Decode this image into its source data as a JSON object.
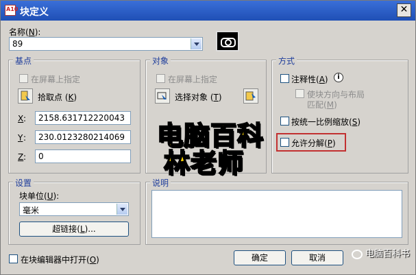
{
  "window": {
    "title": "块定义",
    "app_icon_text": "A10"
  },
  "name_field": {
    "label": "名称",
    "hotkey": "N",
    "value": "89"
  },
  "base_point": {
    "group_title": "基点",
    "specify_on_screen": "在屏幕上指定",
    "pick_point": "拾取点",
    "pick_point_hotkey": "K",
    "x_label": "X",
    "x_value": "2158.631712220043",
    "y_label": "Y",
    "y_value": "230.0123280214069",
    "z_label": "Z",
    "z_value": "0"
  },
  "objects": {
    "group_title": "对象",
    "specify_on_screen": "在屏幕上指定",
    "select_objects": "选择对象",
    "select_objects_hotkey": "T"
  },
  "behavior": {
    "group_title": "方式",
    "annotative": "注释性",
    "annotative_hotkey": "A",
    "match_orientation": "使块方向与布局",
    "match_orientation_2": "匹配",
    "match_orientation_hotkey": "M",
    "scale_uniformly": "按统一比例缩放",
    "scale_uniformly_hotkey": "S",
    "allow_exploding": "允许分解",
    "allow_exploding_hotkey": "P"
  },
  "settings": {
    "group_title": "设置",
    "block_unit_label": "块单位",
    "block_unit_hotkey": "U",
    "block_unit_value": "毫米",
    "hyperlink_button": "超链接",
    "hyperlink_hotkey": "L"
  },
  "description": {
    "group_title": "说明"
  },
  "footer": {
    "open_in_editor": "在块编辑器中打开",
    "open_in_editor_hotkey": "O",
    "ok_button": "确定",
    "cancel_button": "取消"
  },
  "watermark": {
    "line1": "电脑百科",
    "line2": "林老师",
    "corner": "电脑百科书"
  }
}
